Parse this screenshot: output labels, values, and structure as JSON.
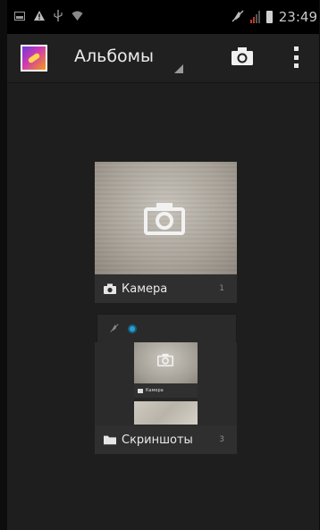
{
  "status_bar": {
    "icons": [
      "image-icon",
      "warning-icon",
      "usb-icon",
      "wifi-icon",
      "mute-icon",
      "signal-icon",
      "battery-icon"
    ],
    "time": "23:49"
  },
  "action_bar": {
    "app_icon": "gallery-icon",
    "title": "Альбомы",
    "camera_icon": "camera-icon",
    "menu_icon": "overflow-menu-icon"
  },
  "albums": [
    {
      "name": "Камера",
      "count": "1",
      "icon": "camera-icon"
    },
    {
      "name": "Скриншоты",
      "count": "3",
      "icon": "folder-icon"
    }
  ],
  "screenshot_preview": {
    "album_name": "Камера"
  },
  "colors": {
    "background": "#1e1e1e",
    "action_bar": "#202020",
    "accent_blue": "#2a9fd6"
  }
}
